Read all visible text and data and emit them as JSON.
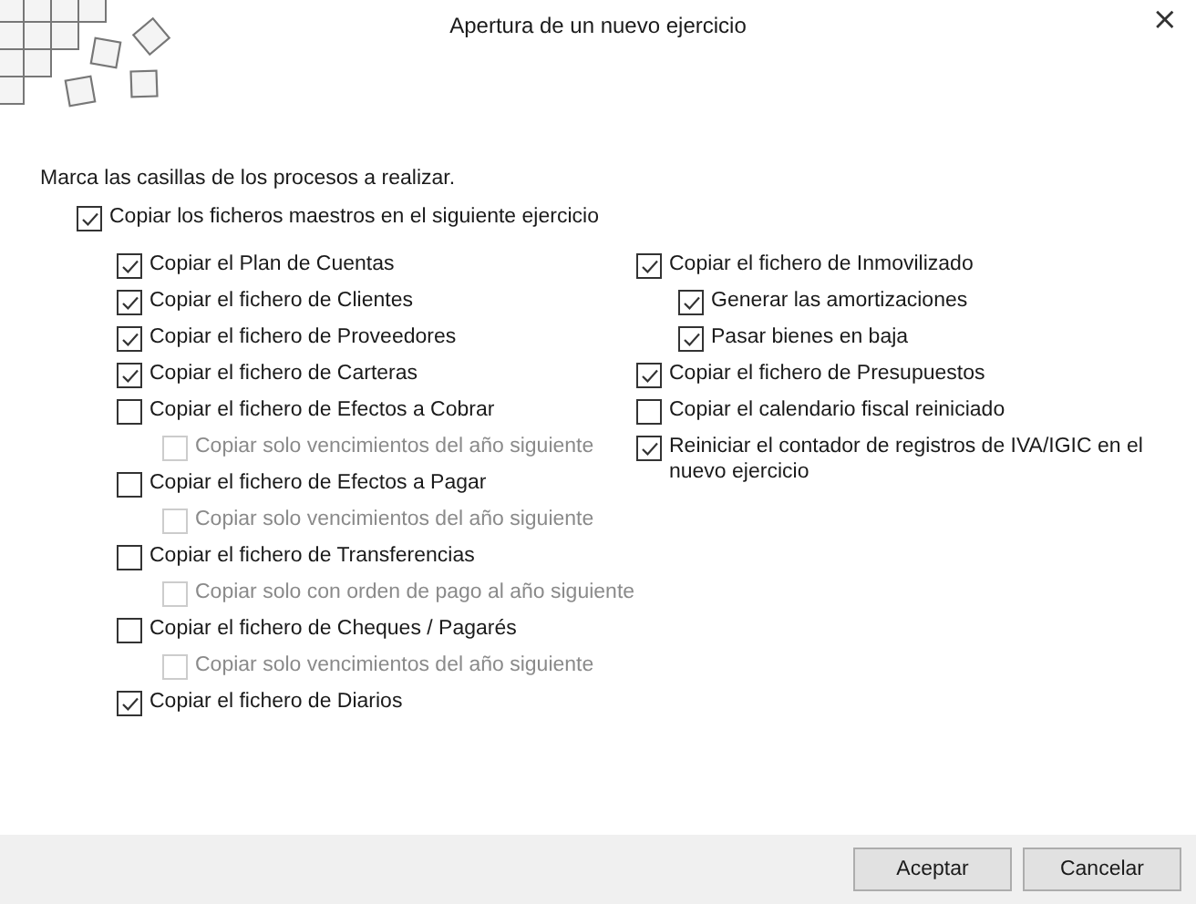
{
  "window": {
    "title": "Apertura de un nuevo ejercicio",
    "close": "×"
  },
  "instruction": "Marca las casillas de los procesos a realizar.",
  "master": {
    "label": "Copiar los ficheros maestros en el siguiente ejercicio",
    "checked": true,
    "disabled": false
  },
  "left_column": [
    {
      "label": "Copiar el Plan de Cuentas",
      "checked": true,
      "disabled": false
    },
    {
      "label": "Copiar el fichero de Clientes",
      "checked": true,
      "disabled": false
    },
    {
      "label": "Copiar el fichero de Proveedores",
      "checked": true,
      "disabled": false
    },
    {
      "label": "Copiar el fichero de Carteras",
      "checked": true,
      "disabled": false
    },
    {
      "label": "Copiar el fichero de Efectos a Cobrar",
      "checked": false,
      "disabled": false,
      "children": [
        {
          "label": "Copiar solo vencimientos del año siguiente",
          "checked": false,
          "disabled": true
        }
      ]
    },
    {
      "label": "Copiar el fichero de Efectos a Pagar",
      "checked": false,
      "disabled": false,
      "children": [
        {
          "label": "Copiar solo vencimientos del año siguiente",
          "checked": false,
          "disabled": true
        }
      ]
    },
    {
      "label": "Copiar el fichero de Transferencias",
      "checked": false,
      "disabled": false,
      "children": [
        {
          "label": "Copiar solo con orden de pago al año siguiente",
          "checked": false,
          "disabled": true
        }
      ]
    },
    {
      "label": "Copiar el fichero de Cheques / Pagarés",
      "checked": false,
      "disabled": false,
      "children": [
        {
          "label": "Copiar solo vencimientos del año siguiente",
          "checked": false,
          "disabled": true
        }
      ]
    },
    {
      "label": "Copiar el fichero de Diarios",
      "checked": true,
      "disabled": false
    }
  ],
  "right_column": [
    {
      "label": "Copiar el fichero de Inmovilizado",
      "checked": true,
      "disabled": false,
      "children": [
        {
          "label": "Generar las amortizaciones",
          "checked": true,
          "disabled": false
        },
        {
          "label": "Pasar bienes en baja",
          "checked": true,
          "disabled": false
        }
      ]
    },
    {
      "label": "Copiar el fichero de Presupuestos",
      "checked": true,
      "disabled": false
    },
    {
      "label": "Copiar el calendario fiscal reiniciado",
      "checked": false,
      "disabled": false
    },
    {
      "label": "Reiniciar el contador de registros de IVA/IGIC en el nuevo ejercicio",
      "checked": true,
      "disabled": false
    }
  ],
  "buttons": [
    "Aceptar",
    "Cancelar"
  ]
}
